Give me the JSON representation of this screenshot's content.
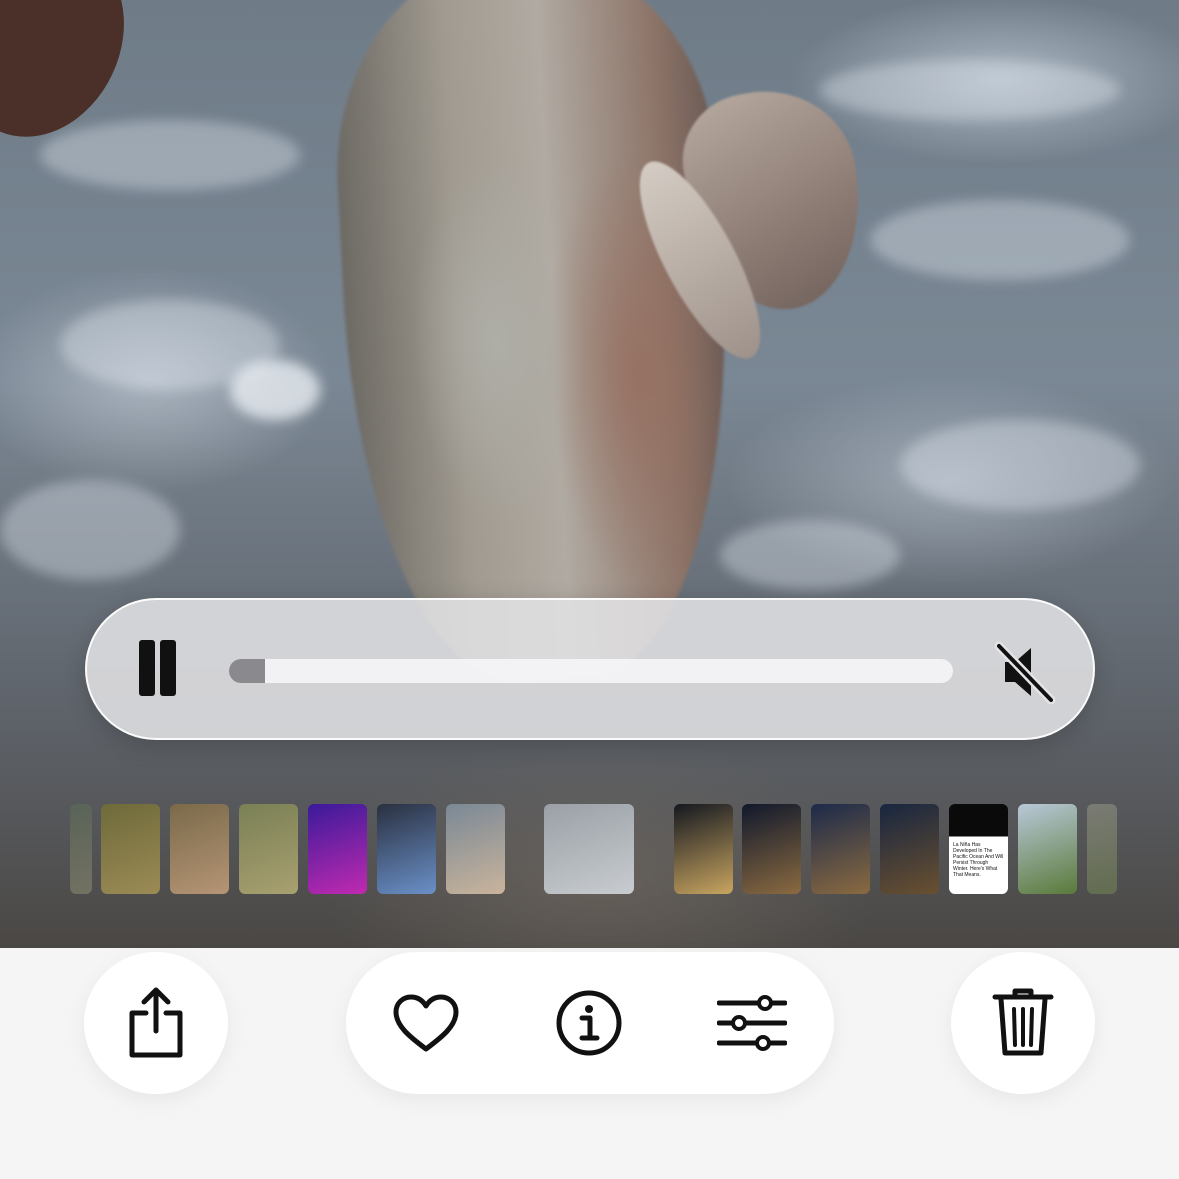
{
  "player": {
    "state": "playing",
    "progress": 0.05,
    "muted": true
  },
  "icons": {
    "pause": "pause-icon",
    "mute": "speaker-slash-icon",
    "share": "share-icon",
    "favorite": "heart-icon",
    "info": "info-icon",
    "adjust": "sliders-icon",
    "delete": "trash-icon"
  },
  "thumbnails": [
    {
      "kind": "photo",
      "colors": [
        "#5a6a55",
        "#8b8a70"
      ]
    },
    {
      "kind": "photo",
      "colors": [
        "#6e6a3a",
        "#9b8b55"
      ]
    },
    {
      "kind": "photo",
      "colors": [
        "#7a6a4a",
        "#b59575"
      ]
    },
    {
      "kind": "photo",
      "colors": [
        "#7a8055",
        "#a8a070"
      ]
    },
    {
      "kind": "photo",
      "colors": [
        "#3a1a9a",
        "#c02ab0"
      ]
    },
    {
      "kind": "photo",
      "colors": [
        "#2a3040",
        "#6a90c8"
      ]
    },
    {
      "kind": "photo",
      "colors": [
        "#7a8896",
        "#c9b49c"
      ]
    },
    {
      "kind": "current",
      "colors": [
        "#9aa0a6",
        "#c8ccd0"
      ]
    },
    {
      "kind": "photo",
      "colors": [
        "#141820",
        "#c9a560"
      ]
    },
    {
      "kind": "photo",
      "colors": [
        "#10182c",
        "#8a6a40"
      ]
    },
    {
      "kind": "photo",
      "colors": [
        "#1c2a4a",
        "#8a6a40"
      ]
    },
    {
      "kind": "photo",
      "colors": [
        "#182640",
        "#6a5030"
      ]
    },
    {
      "kind": "document",
      "colors": [
        "#0a0a0a",
        "#ffffff"
      ],
      "text": "La Niña Has Developed In The Pacific Ocean And Will Persist Through Winter. Here's What That Means."
    },
    {
      "kind": "photo",
      "colors": [
        "#b8c8d8",
        "#5a7a3a"
      ]
    },
    {
      "kind": "photo",
      "colors": [
        "#8a8a80",
        "#6a7a50"
      ]
    }
  ]
}
